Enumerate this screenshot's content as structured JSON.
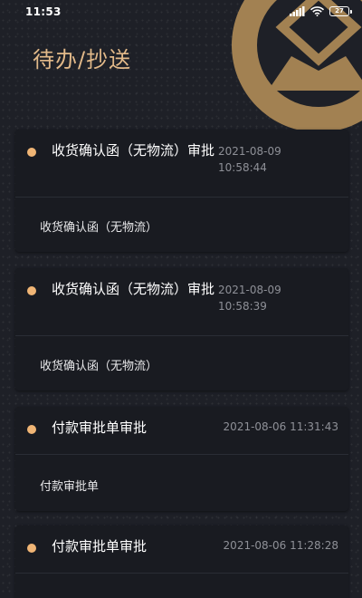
{
  "status_bar": {
    "time": "11:53",
    "signal_icon": "signal-bars-icon",
    "wifi_icon": "wifi-icon",
    "battery_level": "27",
    "battery_icon": "battery-icon"
  },
  "header": {
    "title": "待办/抄送",
    "emblem_icon": "emblem-logo-icon",
    "accent_color": "#e2b989"
  },
  "colors": {
    "background": "#1e2027",
    "card": "#191b21",
    "dot": "#f0b575",
    "time_text": "#8e9097"
  },
  "items": [
    {
      "title": "收货确认函（无物流）审批",
      "time": "2021-08-09 10:58:44",
      "description": "收货确认函（无物流）"
    },
    {
      "title": "收货确认函（无物流）审批",
      "time": "2021-08-09 10:58:39",
      "description": "收货确认函（无物流）"
    },
    {
      "title": "付款审批单审批",
      "time": "2021-08-06 11:31:43",
      "description": "付款审批单"
    },
    {
      "title": "付款审批单审批",
      "time": "2021-08-06 11:28:28",
      "description": ""
    }
  ]
}
